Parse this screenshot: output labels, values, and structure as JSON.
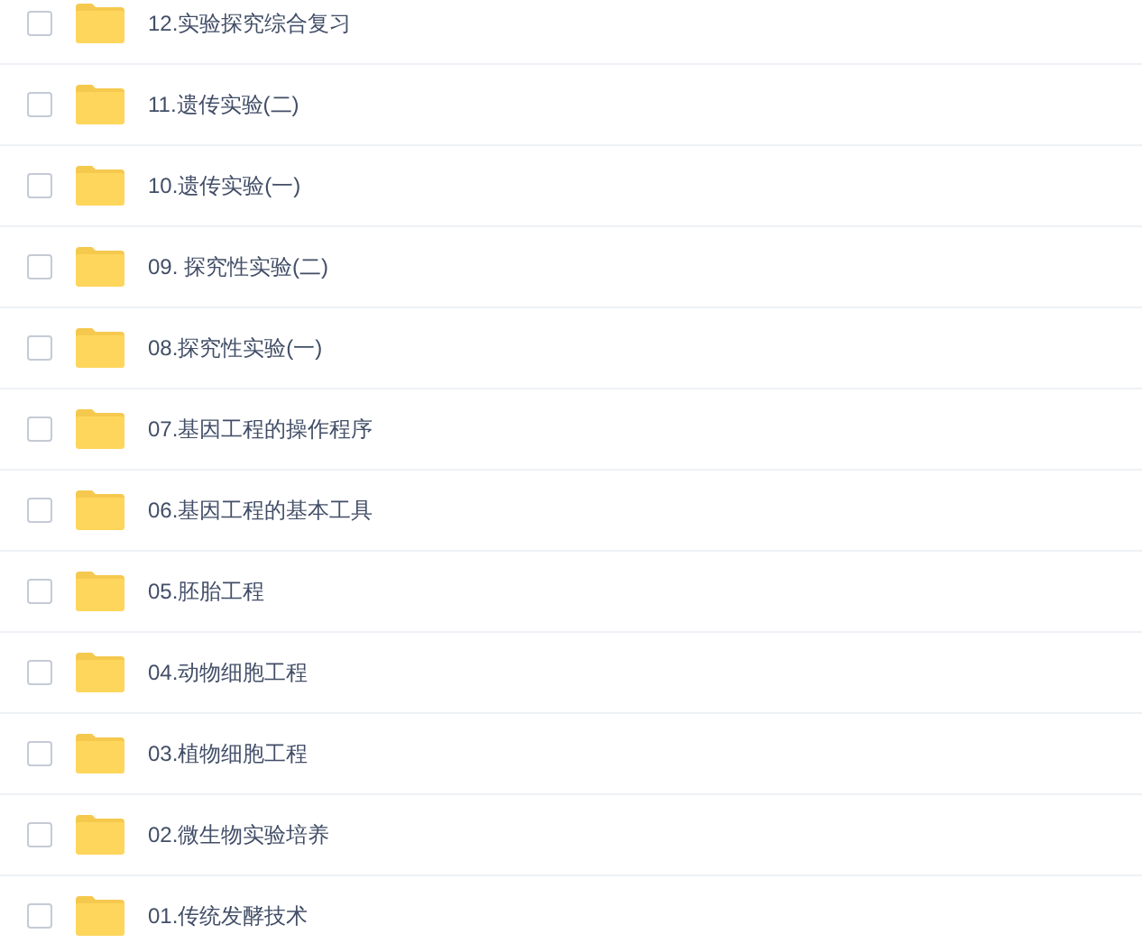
{
  "files": [
    {
      "name": "12.实验探究综合复习",
      "checked": false
    },
    {
      "name": "11.遗传实验(二)",
      "checked": false
    },
    {
      "name": "10.遗传实验(一)",
      "checked": false
    },
    {
      "name": "09. 探究性实验(二)",
      "checked": false
    },
    {
      "name": "08.探究性实验(一)",
      "checked": false
    },
    {
      "name": "07.基因工程的操作程序",
      "checked": false
    },
    {
      "name": "06.基因工程的基本工具",
      "checked": false
    },
    {
      "name": "05.胚胎工程",
      "checked": false
    },
    {
      "name": "04.动物细胞工程",
      "checked": false
    },
    {
      "name": "03.植物细胞工程",
      "checked": false
    },
    {
      "name": "02.微生物实验培养",
      "checked": false
    },
    {
      "name": "01.传统发酵技术",
      "checked": false
    }
  ]
}
